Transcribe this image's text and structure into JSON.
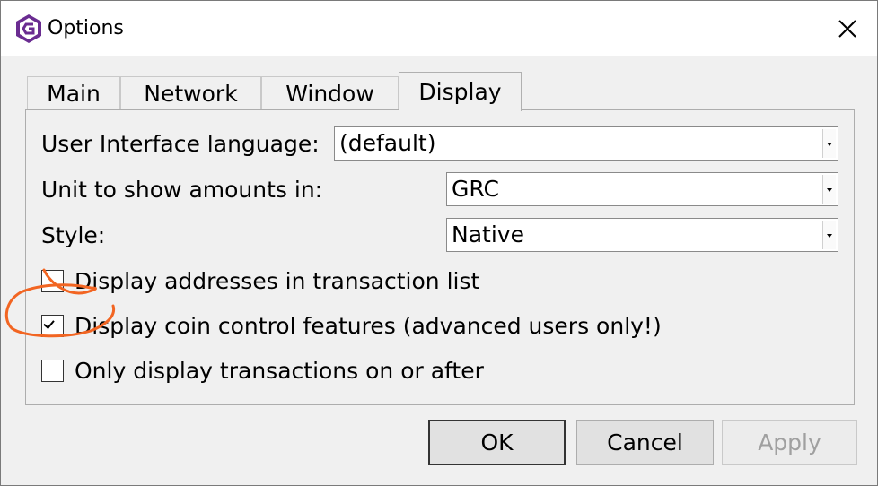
{
  "window": {
    "title": "Options",
    "icon": "gridcoin-logo-icon",
    "close_icon": "close-icon"
  },
  "tabs": [
    {
      "label": "Main",
      "active": false
    },
    {
      "label": "Network",
      "active": false
    },
    {
      "label": "Window",
      "active": false
    },
    {
      "label": "Display",
      "active": true
    }
  ],
  "display": {
    "language_label": "User Interface language:",
    "language_value": "(default)",
    "unit_label": "Unit to show amounts in:",
    "unit_value": "GRC",
    "style_label": "Style:",
    "style_value": "Native",
    "checkboxes": [
      {
        "label": "Display addresses in transaction list",
        "checked": false
      },
      {
        "label": "Display coin control features (advanced users only!)",
        "checked": true
      },
      {
        "label": "Only display transactions on or after",
        "checked": false
      }
    ]
  },
  "buttons": {
    "ok": "OK",
    "cancel": "Cancel",
    "apply": "Apply"
  },
  "colors": {
    "annotation": "#f26522",
    "logo": "#6a2c91"
  }
}
